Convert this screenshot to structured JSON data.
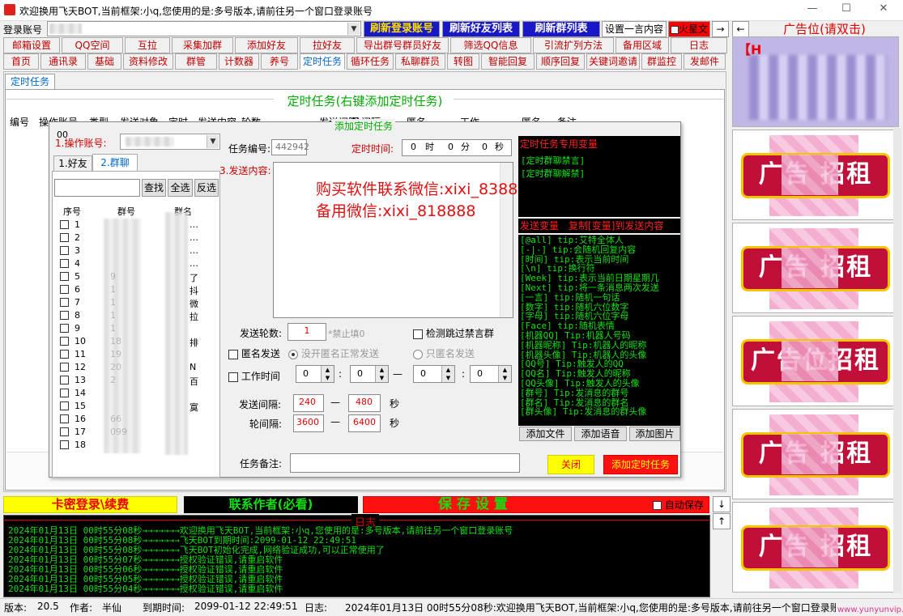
{
  "window": {
    "title": "欢迎换用飞天BOT,当前框架:小q,您使用的是:多号版本,请前往另一个窗口登录账号",
    "min": "—",
    "max": "☐",
    "close": "✕"
  },
  "toolbar": {
    "login_label": "登录账号",
    "login_value": "",
    "refresh_login": "刷新登录账号",
    "refresh_friends": "刷新好友列表",
    "refresh_groups": "刷新群列表",
    "set_one_word": "设置一言内容",
    "fire_star": "火星文",
    "arrow_right": "→",
    "arrow_left": "←",
    "ad_title": "广告位(请双击)"
  },
  "menu_row1": [
    "邮箱设置",
    "QQ空间",
    "互拉",
    "采集加群",
    "添加好友",
    "拉好友",
    "导出群号群员好友",
    "筛选QQ信息",
    "引流扩列方法",
    "备用区域",
    "日志"
  ],
  "menu_row2": [
    "首页",
    "通讯录",
    "基础",
    "资料修改",
    "群管",
    "计数器",
    "养号",
    "定时任务",
    "循环任务",
    "私聊群员",
    "转图",
    "智能回复",
    "顺序回复",
    "关键词邀请",
    "群监控",
    "发邮件"
  ],
  "menu_row2_active": 7,
  "subtab": "定时任务",
  "section_title": "定时任务(右键添加定时任务)",
  "table_headers": [
    "编号",
    "操作账号",
    "类型",
    "发送对象",
    "定时",
    "发送内容",
    "轮数",
    "发送间隔",
    "轮间隔",
    "匿名",
    "工作",
    "匿名",
    "备注"
  ],
  "dialog": {
    "title": "添加定时任务",
    "corner_label": "00",
    "account_label": "1.操作账号:",
    "account_value": "",
    "tabs": [
      "1.好友",
      "2.群聊"
    ],
    "tab_active": 1,
    "search_value": "",
    "buttons": {
      "find": "查找",
      "select_all": "全选",
      "invert": "反选",
      "close": "关闭",
      "add": "添加定时任务"
    },
    "list_headers": [
      "序号",
      "群号",
      "群名"
    ],
    "list_rows": [
      {
        "no": "1",
        "num": "",
        "name": "…"
      },
      {
        "no": "2",
        "num": "",
        "name": "…"
      },
      {
        "no": "3",
        "num": "",
        "name": "…"
      },
      {
        "no": "4",
        "num": "",
        "name": "…"
      },
      {
        "no": "5",
        "num": "9",
        "name": "了"
      },
      {
        "no": "6",
        "num": "1",
        "name": "抖"
      },
      {
        "no": "7",
        "num": "1",
        "name": "微"
      },
      {
        "no": "8",
        "num": "1",
        "name": "拉"
      },
      {
        "no": "9",
        "num": "1",
        "name": ""
      },
      {
        "no": "10",
        "num": "18",
        "name": "排"
      },
      {
        "no": "11",
        "num": "19",
        "name": ""
      },
      {
        "no": "12",
        "num": "20",
        "name": "N"
      },
      {
        "no": "13",
        "num": "2",
        "name": "百"
      },
      {
        "no": "14",
        "num": "",
        "name": ""
      },
      {
        "no": "15",
        "num": "",
        "name": "寞"
      },
      {
        "no": "16",
        "num": "66",
        "name": ""
      },
      {
        "no": "17",
        "num": "099",
        "name": ""
      },
      {
        "no": "18",
        "num": "",
        "name": ""
      }
    ],
    "task_no_label": "任务编号:",
    "task_no": "442942",
    "time_label": "定时时间:",
    "time_h": "0",
    "time_h_unit": "时",
    "time_m": "0",
    "time_m_unit": "分",
    "time_s": "0",
    "time_s_unit": "秒",
    "content_label": "3.发送内容:",
    "watermark1": "购买软件联系微信:xixi_838888",
    "watermark2": "备用微信:xixi_818888",
    "rounds_label": "发送轮数:",
    "rounds": "1",
    "rounds_hint": "*禁止填0",
    "skip_ban": "检测跳过禁言群",
    "anon_send": "匿名发送",
    "anon_opt1": "没开匿名正常发送",
    "anon_opt2": "只匿名发送",
    "work_time": "工作时间",
    "wt1": "0",
    "wt2": "0",
    "wt3": "0",
    "wt4": "0",
    "dash": "—",
    "colon": ":",
    "interval_label": "发送间隔:",
    "interval_min": "240",
    "interval_max": "480",
    "sec1": "秒",
    "round_label": "轮间隔:",
    "round_min": "3600",
    "round_max": "6400",
    "sec2": "秒",
    "remark_label": "任务备注:",
    "remark_value": "",
    "var_title": "定时任务专用变量",
    "vars_special": [
      "[定时群聊禁言]",
      "[定时群聊解禁]"
    ],
    "var_send_title": "发送变量",
    "var_copy_title": "复制[变量]到发送内容",
    "vars": [
      "[@all]      tip:艾特全体人",
      "[-|-]      tip:会随机回复内容",
      "[时间]     tip:表示当前时间",
      "[\\n]       tip:换行符",
      "[Week]     tip:表示当前日期星期几",
      "[Next]     tip:将一条消息两次发送",
      "[一言]     tip:随机一句话",
      "[数字]     tip:随机六位数字",
      "[字母]     tip:随机六位字母",
      "[Face]     tip:随机表情",
      "[机器QQ]   Tip:机器人号码",
      "[机器昵称] Tip:机器人的昵称",
      "[机器头像] Tip:机器人的头像",
      "[QQ号]     Tip:触发人的QQ",
      "[QQ名]     Tip:触发人的昵称",
      "[QQ头像]   Tip:触发人的头像",
      "[群号]     Tip:发消息的群号",
      "[群名]     Tip:发消息的群名",
      "[群头像]   Tip:发消息的群头像"
    ],
    "add_file": "添加文件",
    "add_voice": "添加语音",
    "add_image": "添加图片"
  },
  "bottom_bar": {
    "card_login": "卡密登录\\续费",
    "contact": "联系作者(必看)",
    "save": "保    存    设    置",
    "auto_save": "自动保存",
    "down": "↓",
    "up": "↑"
  },
  "log": {
    "title": "日志",
    "lines": [
      "2024年01月13日 00时55分08秒→→→→→→→欢迎换用飞天BOT,当前框架:小q,您使用的是:多号版本,请前往另一个窗口登录账号",
      "2024年01月13日 00时55分08秒→→→→→→→飞天BOT到期时间:2099-01-12 22:49:51",
      "2024年01月13日 00时55分08秒→→→→→→→飞天BOT初始化完成,网络验证成功,可以正常使用了",
      "2024年01月13日 00时55分07秒→→→→→→→授权验证错误,请重启软件",
      "2024年01月13日 00时55分06秒→→→→→→→授权验证错误,请重启软件",
      "2024年01月13日 00时55分05秒→→→→→→→授权验证错误,请重启软件",
      "2024年01月13日 00时55分04秒→→→→→→→授权验证错误,请重启软件"
    ]
  },
  "status": {
    "version_label": "版本:",
    "version": "20.5",
    "author_label": "作者:",
    "author": "半仙",
    "expire_label": "到期时间:",
    "expire": "2099-01-12 22:49:51",
    "log_label": "日志:",
    "log_text": "2024年01月13日 00时55分08秒:欢迎换用飞天BOT,当前框架:小q,您使用的是:多号版本,请前往另一个窗口登录账号",
    "watermark": "www.yunyunvip.com"
  },
  "ads": {
    "top_text": "【H",
    "badges": [
      "广告  招租",
      "广告  招租",
      "广告位招租",
      "广告  招租",
      "广告  招租"
    ]
  }
}
